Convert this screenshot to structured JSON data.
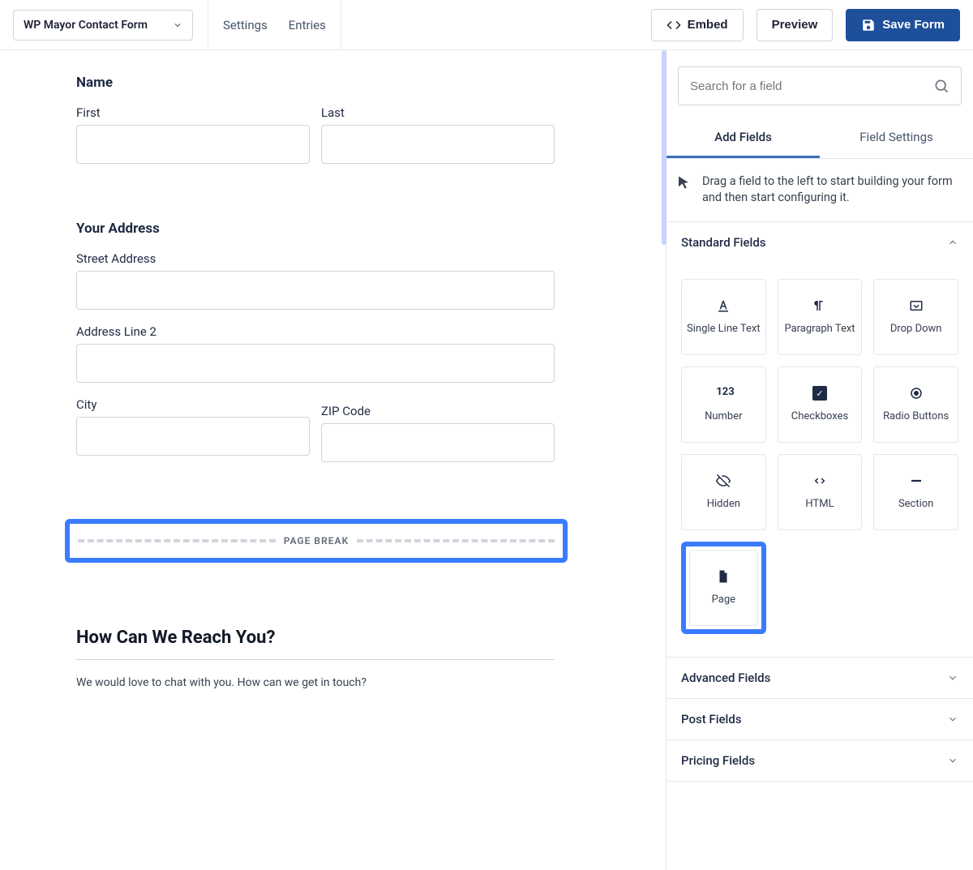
{
  "header": {
    "form_name": "WP Mayor Contact Form",
    "nav": {
      "settings": "Settings",
      "entries": "Entries"
    },
    "embed": "Embed",
    "preview": "Preview",
    "save": "Save Form"
  },
  "canvas": {
    "name": {
      "title": "Name",
      "first": "First",
      "last": "Last"
    },
    "address": {
      "title": "Your Address",
      "street": "Street Address",
      "line2": "Address Line 2",
      "city": "City",
      "zip": "ZIP Code"
    },
    "page_break": "PAGE BREAK",
    "reach": {
      "title": "How Can We Reach You?",
      "desc": "We would love to chat with you. How can we get in touch?"
    }
  },
  "sidebar": {
    "search_placeholder": "Search for a field",
    "tabs": {
      "add": "Add Fields",
      "settings": "Field Settings"
    },
    "hint": "Drag a field to the left to start building your form and then start configuring it.",
    "groups": {
      "standard": "Standard Fields",
      "advanced": "Advanced Fields",
      "post": "Post Fields",
      "pricing": "Pricing Fields"
    },
    "fields": {
      "single_line": "Single Line Text",
      "paragraph": "Paragraph Text",
      "dropdown": "Drop Down",
      "number": "Number",
      "checkboxes": "Checkboxes",
      "radio": "Radio Buttons",
      "hidden": "Hidden",
      "html": "HTML",
      "section": "Section",
      "page": "Page"
    }
  }
}
